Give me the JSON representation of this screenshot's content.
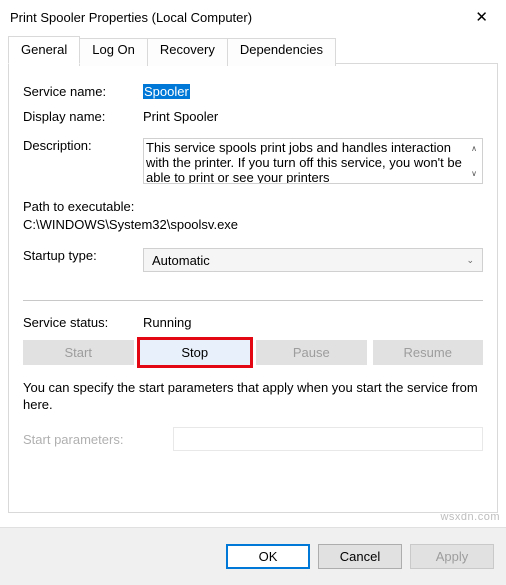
{
  "window": {
    "title": "Print Spooler Properties (Local Computer)"
  },
  "tabs": {
    "t0": "General",
    "t1": "Log On",
    "t2": "Recovery",
    "t3": "Dependencies"
  },
  "labels": {
    "service_name": "Service name:",
    "display_name": "Display name:",
    "description": "Description:",
    "path_label": "Path to executable:",
    "startup_type": "Startup type:",
    "service_status": "Service status:",
    "start_params": "Start parameters:"
  },
  "values": {
    "service_name": "Spooler",
    "display_name": "Print Spooler",
    "description": "This service spools print jobs and handles interaction with the printer.  If you turn off this service, you won't be able to print or see your printers",
    "path": "C:\\WINDOWS\\System32\\spoolsv.exe",
    "startup_type": "Automatic",
    "service_status": "Running",
    "start_params": ""
  },
  "buttons": {
    "start": "Start",
    "stop": "Stop",
    "pause": "Pause",
    "resume": "Resume",
    "ok": "OK",
    "cancel": "Cancel",
    "apply": "Apply"
  },
  "note": "You can specify the start parameters that apply when you start the service from here.",
  "watermark": "wsxdn.com"
}
